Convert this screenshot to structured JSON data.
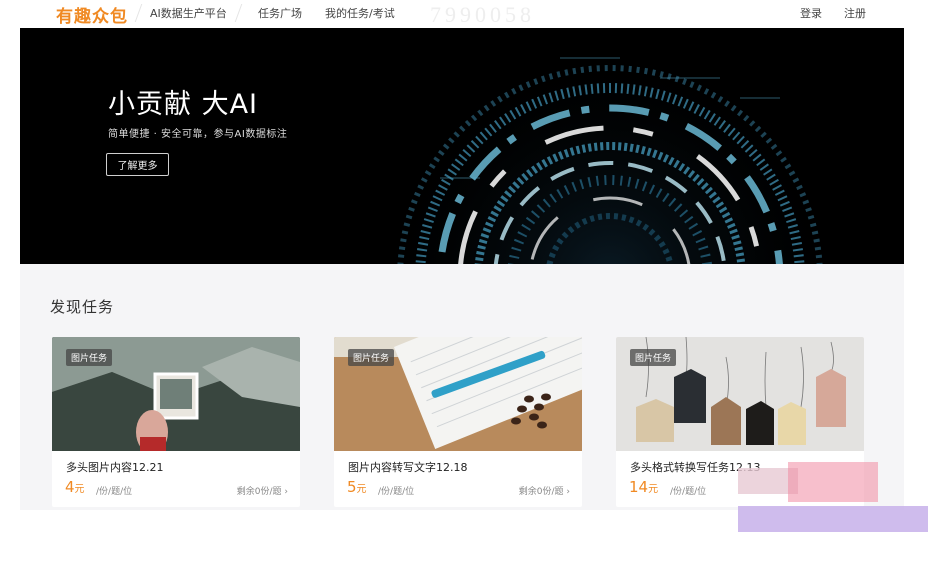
{
  "nav": {
    "logo": "有趣众包",
    "links": [
      "AI数据生产平台",
      "任务广场",
      "我的任务/考试"
    ],
    "right": [
      "登录",
      "注册"
    ],
    "ghost": "7990058"
  },
  "banner": {
    "title": "小贡献 大AI",
    "subtitle": "简单便捷 · 安全可靠，参与AI数据标注",
    "button": "了解更多"
  },
  "section": {
    "title": "发现任务"
  },
  "cards": [
    {
      "tag": "图片任务",
      "title": "多头图片内容12.21",
      "price": "4",
      "unit": "元",
      "meta": "/份/题/位",
      "extra": "剩余0份/题 ›"
    },
    {
      "tag": "图片任务",
      "title": "图片内容转写文字12.18",
      "price": "5",
      "unit": "元",
      "meta": "/份/题/位",
      "extra": "剩余0份/题 ›"
    },
    {
      "tag": "图片任务",
      "title": "多头格式转换写任务12.13",
      "price": "14",
      "unit": "元",
      "meta": "/份/题/位",
      "extra": ""
    }
  ],
  "colors": {
    "accent": "#f08a24",
    "banner_bg": "#000000",
    "ring": "#5fb8d8",
    "content_bg": "#f5f5f7"
  }
}
